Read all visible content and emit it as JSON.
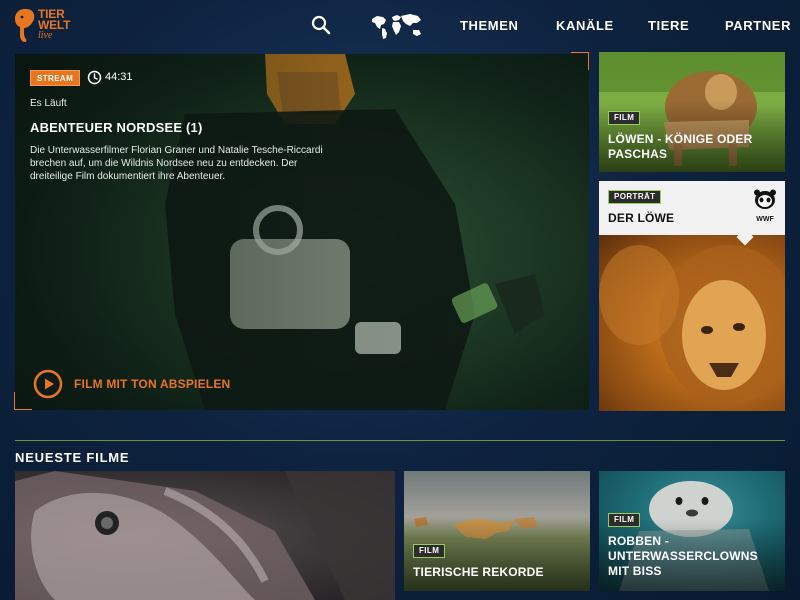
{
  "header": {
    "logo": {
      "line1": "TIER",
      "line2": "WELT",
      "line3": "live"
    },
    "search_icon": "search-icon",
    "map_icon": "world-map-icon",
    "nav": [
      {
        "label": "THEMEN"
      },
      {
        "label": "KANÄLE"
      },
      {
        "label": "TIERE"
      },
      {
        "label": "PARTNER"
      }
    ]
  },
  "hero": {
    "badge": "STREAM",
    "duration": "44:31",
    "status": "Es Läuft",
    "title": "ABENTEUER NORDSEE (1)",
    "description": "Die Unterwasserfilmer Florian Graner und Natalie Tesche-Riccardi brechen auf, um die Wildnis Nordsee neu zu entdecken. Der dreiteilige Film dokumentiert ihre Abenteuer.",
    "play_label": "FILM MIT TON ABSPIELEN",
    "play_icon": "play-circle-icon",
    "clock_icon": "clock-icon"
  },
  "side_cards": [
    {
      "tag": "FILM",
      "title": "LÖWEN - KÖNIGE ODER PASCHAS"
    },
    {
      "tag": "PORTRÄT",
      "title": "DER LÖWE",
      "partner_logo": "WWF"
    }
  ],
  "latest": {
    "section_title": "NEUESTE FILME",
    "cards": [
      {
        "tag": "",
        "title": ""
      },
      {
        "tag": "FILM",
        "title": "TIERISCHE REKORDE"
      },
      {
        "tag": "FILM",
        "title": "ROBBEN - UNTERWASSERCLOWNS MIT BISS"
      }
    ]
  },
  "colors": {
    "accent": "#e8761f",
    "tag_border": "#9ccf5a",
    "background": "#0e2340"
  }
}
